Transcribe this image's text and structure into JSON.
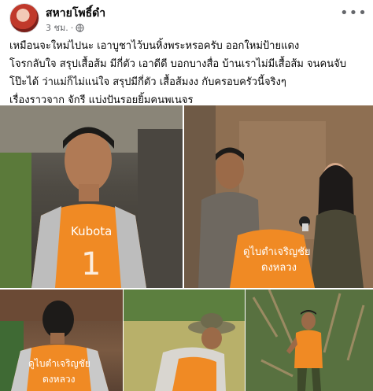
{
  "post": {
    "author": "สหายโพธิ์ดำ",
    "time": "3 ชม.",
    "privacy_icon": "globe-icon",
    "more_icon": "more-dots-icon",
    "caption_lines": [
      "เหมือนจะใหม่ไปนะ เอาบูชาไว้บนหิ้งพระหรอครับ ออกใหม่ป้ายแดง",
      "โจรกลับใจ สรุปเสื้อส้ม มีกี่ตัว เอาดีดี บอกบางสื่อ บ้านเราไม่มีเสื้อส้ม จนคนจับ",
      "โป๊ะได้ ว่าแม่ก็ไม่แน่ใจ สรุปมีกี่ตัว เสื้อส้มงง กับครอบครัวนี้จริงๆ",
      "เรื่องราวจาก จักรี แบ่งปันรอยยิ้มคนพเนจร"
    ]
  },
  "photos": {
    "photo1_shirt_text": "Kubota",
    "photo2_shirt_text_1": "ดูไบตำเจริญชัย",
    "photo2_shirt_text_2": "ดงหลวง",
    "photo3_shirt_text_1": "ดูไบตำเจริญชัย",
    "photo3_shirt_text_2": "ดงหลวง"
  },
  "colors": {
    "orange_shirt": "#f08a24",
    "link_gray": "#65676b",
    "text": "#050505"
  }
}
